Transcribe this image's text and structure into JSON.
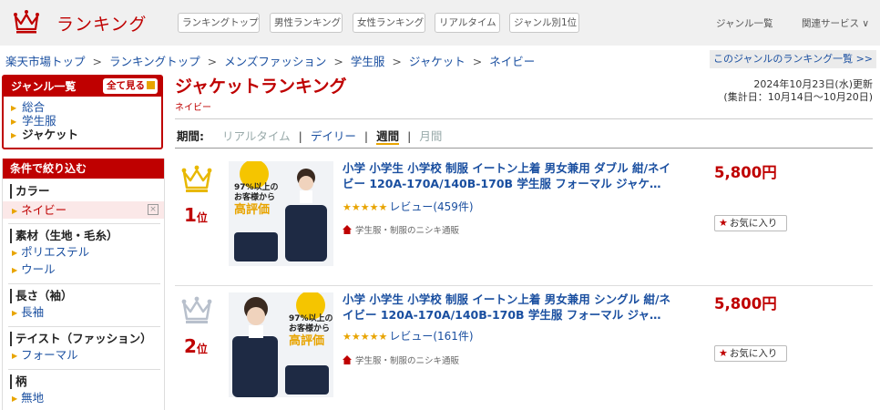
{
  "header": {
    "logo_text": "ランキング",
    "tabs": [
      "ランキングトップ",
      "男性ランキング",
      "女性ランキング",
      "リアルタイム",
      "ジャンル別1位"
    ],
    "genre_list": "ジャンル一覧",
    "related": "関連サービス ∨",
    "crown_color": "#bf0000"
  },
  "breadcrumb": {
    "items": [
      "楽天市場トップ",
      "ランキングトップ",
      "メンズファッション",
      "学生服",
      "ジャケット",
      "ネイビー"
    ],
    "separator": ">"
  },
  "genre_list_link": "このジャンルのランキング一覧 >>",
  "sidebar": {
    "genre_title": "ジャンル一覧",
    "all_button": "全て見る",
    "genres": [
      "総合",
      "学生服",
      "ジャケット"
    ],
    "filter_title": "条件で絞り込む",
    "groups": [
      {
        "head": "カラー",
        "options": [
          "ネイビー"
        ]
      },
      {
        "head": "素材（生地・毛糸）",
        "options": [
          "ポリエステル",
          "ウール"
        ]
      },
      {
        "head": "長さ（袖）",
        "options": [
          "長袖"
        ]
      },
      {
        "head": "テイスト（ファッション）",
        "options": [
          "フォーマル"
        ]
      },
      {
        "head": "柄",
        "options": [
          "無地"
        ]
      }
    ],
    "clear_mark": "×"
  },
  "main": {
    "title": "ジャケットランキング",
    "subtitle": "ネイビー",
    "updated_line1": "2024年10月23日(水)更新",
    "updated_line2": "(集計日：10月14日～10月20日)",
    "period_label": "期間:",
    "period_options": [
      "リアルタイム",
      "デイリー",
      "週間",
      "月間"
    ]
  },
  "items": [
    {
      "rank": "1",
      "rank_suffix": "位",
      "crown_color": "#e8b800",
      "title": "小学 小学生 小学校 制服 イートン上着 男女兼用 ダブル 紺/ネイビー 120A-170A/140B-170B 学生服 フォーマル ジャケ…",
      "stars": "★★★★★",
      "reviews": "レビュー(459件)",
      "shop": "学生服・制服のニシキ通販",
      "price": "5,800円",
      "fav": "お気に入り",
      "badge_line1": "97%以上の",
      "badge_line2": "お客様から",
      "badge_line3": "高評価"
    },
    {
      "rank": "2",
      "rank_suffix": "位",
      "crown_color": "#b8c0cc",
      "title": "小学 小学生 小学校 制服 イートン上着 男女兼用 シングル 紺/ネイビー 120A-170A/140B-170B 学生服 フォーマル ジャ…",
      "stars": "★★★★★",
      "reviews": "レビュー(161件)",
      "shop": "学生服・制服のニシキ通販",
      "price": "5,800円",
      "fav": "お気に入り",
      "badge_line1": "97%以上の",
      "badge_line2": "お客様から",
      "badge_line3": "高評価"
    }
  ]
}
